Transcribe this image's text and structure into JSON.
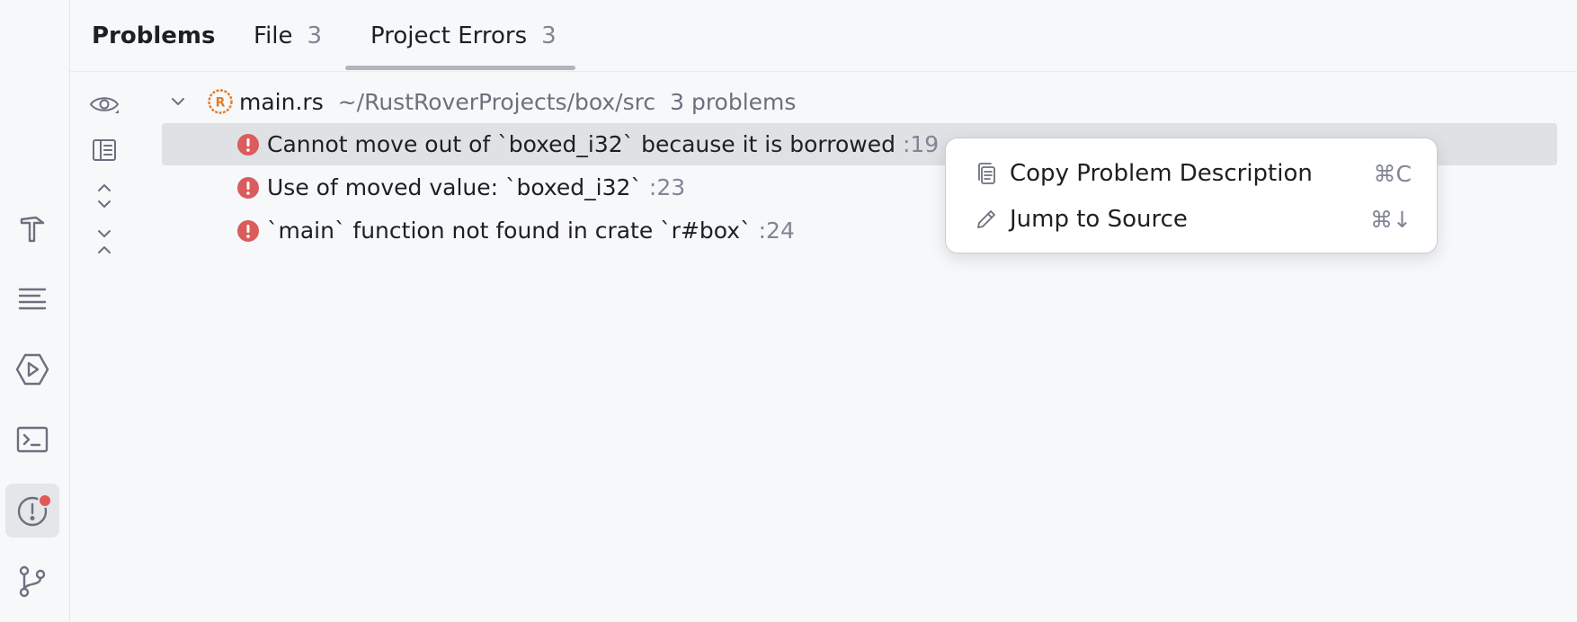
{
  "header": {
    "title": "Problems",
    "tabs": [
      {
        "label": "File",
        "count": "3"
      },
      {
        "label": "Project Errors",
        "count": "3"
      }
    ]
  },
  "toolstrip": {
    "items": [
      {
        "icon": "hammer-icon"
      },
      {
        "icon": "structure-icon"
      },
      {
        "icon": "run-services-icon"
      },
      {
        "icon": "terminal-icon"
      },
      {
        "icon": "problems-icon",
        "active": true
      },
      {
        "icon": "git-branch-icon"
      }
    ]
  },
  "inner_toolbar": {
    "items": [
      "eye-icon",
      "preview-panel-icon",
      "expand-all-icon",
      "collapse-all-icon"
    ]
  },
  "tree": {
    "file": {
      "name": "main.rs",
      "path": "~/RustRoverProjects/box/src",
      "problems": "3 problems"
    },
    "problems": [
      {
        "text": "Cannot move out of `boxed_i32` because it is borrowed",
        "line": ":19",
        "selected": true
      },
      {
        "text": "Use of moved value: `boxed_i32`",
        "line": ":23"
      },
      {
        "text": "`main` function not found in crate `r#box`",
        "line": ":24"
      }
    ]
  },
  "context_menu": {
    "items": [
      {
        "label": "Copy Problem Description",
        "shortcut": "⌘C",
        "icon": "copy-icon"
      },
      {
        "label": "Jump to Source",
        "shortcut": "⌘↓",
        "icon": "pencil-icon"
      }
    ]
  },
  "colors": {
    "error": "#db5c5c",
    "rust": "#e07c2c",
    "selection": "#dfe1e5",
    "notification": "#e55757"
  }
}
